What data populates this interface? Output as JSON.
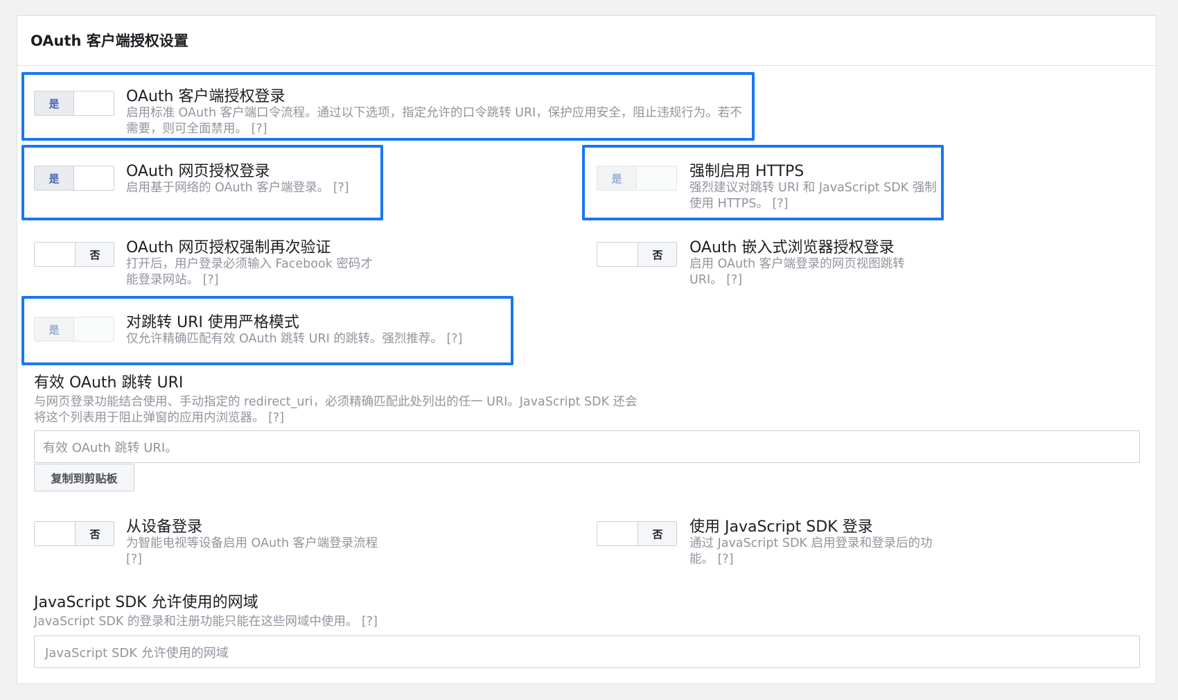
{
  "panel": {
    "title": "OAuth 客户端授权设置"
  },
  "settings": [
    {
      "id": "client_oauth",
      "toggle_label": "是",
      "state": "on",
      "enabled": true,
      "title": "OAuth 客户端授权登录",
      "desc": "启用标准 OAuth 客户端口令流程。通过以下选项，指定允许的口令跳转 URI，保护应用安全，阻止违规行为。若不需要，则可全面禁用。",
      "help": "[?]"
    },
    {
      "id": "web_oauth",
      "toggle_label": "是",
      "state": "on",
      "enabled": true,
      "title": "OAuth 网页授权登录",
      "desc": "启用基于网络的 OAuth 客户端登录。",
      "help": "[?]"
    },
    {
      "id": "force_https",
      "toggle_label": "是",
      "state": "on",
      "enabled": false,
      "title": "强制启用 HTTPS",
      "desc": "强烈建议对跳转 URI 和 JavaScript SDK 强制使用 HTTPS。",
      "help": "[?]"
    },
    {
      "id": "web_reauth",
      "toggle_label": "否",
      "state": "off",
      "enabled": true,
      "title": "OAuth 网页授权强制再次验证",
      "desc": "打开后，用户登录必须输入 Facebook 密码才能登录网站。",
      "help": "[?]"
    },
    {
      "id": "embedded_browser",
      "toggle_label": "否",
      "state": "off",
      "enabled": true,
      "title": "OAuth 嵌入式浏览器授权登录",
      "desc": "启用 OAuth 客户端登录的网页视图跳转 URI。",
      "help": "[?]"
    },
    {
      "id": "strict_mode",
      "toggle_label": "是",
      "state": "on",
      "enabled": false,
      "title": "对跳转 URI 使用严格模式",
      "desc": "仅允许精确匹配有效 OAuth 跳转 URI 的跳转。强烈推荐。",
      "help": "[?]"
    },
    {
      "id": "device_login",
      "toggle_label": "否",
      "state": "off",
      "enabled": true,
      "title": "从设备登录",
      "desc": "为智能电视等设备启用 OAuth 客户端登录流程",
      "help": "[?]"
    },
    {
      "id": "js_sdk_login",
      "toggle_label": "否",
      "state": "off",
      "enabled": true,
      "title": "使用 JavaScript SDK 登录",
      "desc": "通过 JavaScript SDK 启用登录和登录后的功能。",
      "help": "[?]"
    }
  ],
  "redirect_uri": {
    "title": "有效 OAuth 跳转 URI",
    "desc": "与网页登录功能结合使用、手动指定的 redirect_uri，必须精确匹配此处列出的任一 URI。JavaScript SDK 还会将这个列表用于阻止弹窗的应用内浏览器。",
    "help": "[?]",
    "placeholder": "有效 OAuth 跳转 URI。",
    "copy_button": "复制到剪贴板"
  },
  "js_domains": {
    "title": "JavaScript SDK 允许使用的网域",
    "desc": "JavaScript SDK 的登录和注册功能只能在这些网域中使用。",
    "help": "[?]",
    "placeholder": "JavaScript SDK 允许使用的网域"
  },
  "colors": {
    "highlight": "#1877f2",
    "toggle_on_text": "#4267b2",
    "muted_text": "#90949c"
  }
}
